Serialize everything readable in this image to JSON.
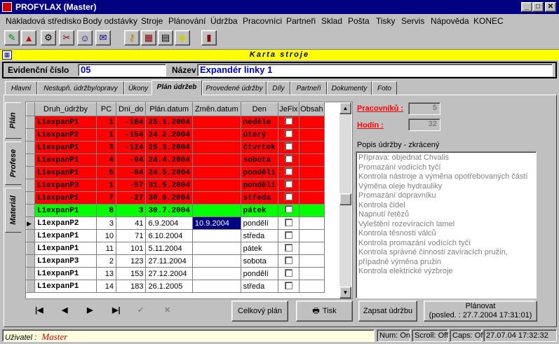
{
  "window": {
    "title": "PROFYLAX (Master)",
    "min": "_",
    "max": "□",
    "close": "✕"
  },
  "menu": [
    "Nákladová středisko",
    "Body odstávky",
    "Stroje",
    "Plánování",
    "Údržba",
    "Pracovníci",
    "Partneři",
    "Sklad",
    "Pošta",
    "Tisky",
    "Servis",
    "Nápověda",
    "KONEC"
  ],
  "toolbar_icons": [
    "pencil-icon",
    "bell-icon",
    "gear-icon",
    "tools-icon",
    "person-icon",
    "mail-icon",
    "key-icon",
    "calendar-icon",
    "calculator-icon",
    "bulb-icon",
    "exit-door-icon"
  ],
  "banner": "Karta stroje",
  "header": {
    "evid_label": "Evidenční číslo",
    "evid_value": "05",
    "name_label": "Název",
    "name_value": "Expandér linky 1"
  },
  "tabs": [
    "Hlavní",
    "Nestupň. údržby/opravy",
    "Úkony",
    "Plán údržeb",
    "Provedené údržby",
    "Díly",
    "Partneři",
    "Dokumenty",
    "Foto"
  ],
  "active_tab": "Plán údržeb",
  "side_tabs": [
    "Plán",
    "Profese",
    "Materiál"
  ],
  "grid": {
    "columns": [
      "Druh_údržby",
      "PC",
      "Dní_do",
      "Plán.datum",
      "Změn.datum",
      "Den",
      "JeFix",
      "Obsah"
    ],
    "rows": [
      {
        "style": "r",
        "druh": "L1expanP1",
        "pc": "1",
        "dni": "-184",
        "plan": "25.1.2004",
        "zmen": "",
        "den": "neděle"
      },
      {
        "style": "r",
        "druh": "L1expanP2",
        "pc": "1",
        "dni": "-154",
        "plan": "24.2.2004",
        "zmen": "",
        "den": "úterý"
      },
      {
        "style": "r",
        "druh": "L1expanP1",
        "pc": "3",
        "dni": "-124",
        "plan": "25.3.2004",
        "zmen": "",
        "den": "čtvrtek"
      },
      {
        "style": "r",
        "druh": "L1expanP1",
        "pc": "4",
        "dni": "-94",
        "plan": "24.4.2004",
        "zmen": "",
        "den": "sobota"
      },
      {
        "style": "r",
        "druh": "L1expanP1",
        "pc": "5",
        "dni": "-64",
        "plan": "24.5.2004",
        "zmen": "",
        "den": "pondělí"
      },
      {
        "style": "r",
        "druh": "L1expanP3",
        "pc": "1",
        "dni": "-57",
        "plan": "31.5.2004",
        "zmen": "",
        "den": "pondělí"
      },
      {
        "style": "r",
        "druh": "L1expanP1",
        "pc": "7",
        "dni": "-27",
        "plan": "30.6.2004",
        "zmen": "",
        "den": "středa"
      },
      {
        "style": "g",
        "druh": "L1expanP1",
        "pc": "8",
        "dni": "3",
        "plan": "30.7.2004",
        "zmen": "",
        "den": "pátek"
      },
      {
        "style": "w",
        "druh": "L1expanP2",
        "pc": "3",
        "dni": "41",
        "plan": "6.9.2004",
        "zmen": "10.9.2004",
        "den": "pondělí",
        "current": true
      },
      {
        "style": "w",
        "druh": "L1expanP1",
        "pc": "10",
        "dni": "71",
        "plan": "6.10.2004",
        "zmen": "",
        "den": "středa"
      },
      {
        "style": "w",
        "druh": "L1expanP1",
        "pc": "11",
        "dni": "101",
        "plan": "5.11.2004",
        "zmen": "",
        "den": "pátek"
      },
      {
        "style": "w",
        "druh": "L1expanP3",
        "pc": "2",
        "dni": "123",
        "plan": "27.11.2004",
        "zmen": "",
        "den": "sobota"
      },
      {
        "style": "w",
        "druh": "L1expanP1",
        "pc": "13",
        "dni": "153",
        "plan": "27.12.2004",
        "zmen": "",
        "den": "pondělí"
      },
      {
        "style": "w",
        "druh": "L1expanP1",
        "pc": "14",
        "dni": "183",
        "plan": "26.1.2005",
        "zmen": "",
        "den": "středa"
      }
    ]
  },
  "nav": {
    "first": "|◀",
    "prev": "◀",
    "next": "▶",
    "last": "▶|",
    "ok": "✓",
    "cancel": "✕"
  },
  "buttons": {
    "celkovy": "Celkový plán",
    "tisk": "Tisk",
    "zapsat": "Zapsat údržbu",
    "planovat1": "Plánovat",
    "planovat2": "(posled. : 27.7.2004 17:31:01)"
  },
  "right": {
    "prac_label": "Pracovníků :",
    "prac_value": "5",
    "hodin_label": "Hodin :",
    "hodin_value": "32",
    "popis_label": "Popis údržby - zkrácený",
    "popis_lines": [
      "Příprava: objednat Chvalis",
      "Promazání vodících tyčí",
      "Kontrola nástroje a výměna opotřebovaných částí",
      "Výměna oleje hydrauliky",
      "Promazání dopravníku",
      "Kontrola čidel",
      "Napnutí řetězů",
      "Vyleštění rozevíracích lamel",
      "Kontrola těsnosti válců",
      "Kontrola promazání vodících tyčí",
      "Kontrola správné činnosti zavíracích pružin,",
      "případně výměna pružin",
      "Kontrola elektrické výzbroje"
    ]
  },
  "status": {
    "user_label": "Uživatel :",
    "user": "Master",
    "num": "Num: On",
    "scroll": "Scroll: Off",
    "caps": "Caps: Off",
    "datetime": "27.07.04 17:32:32"
  }
}
